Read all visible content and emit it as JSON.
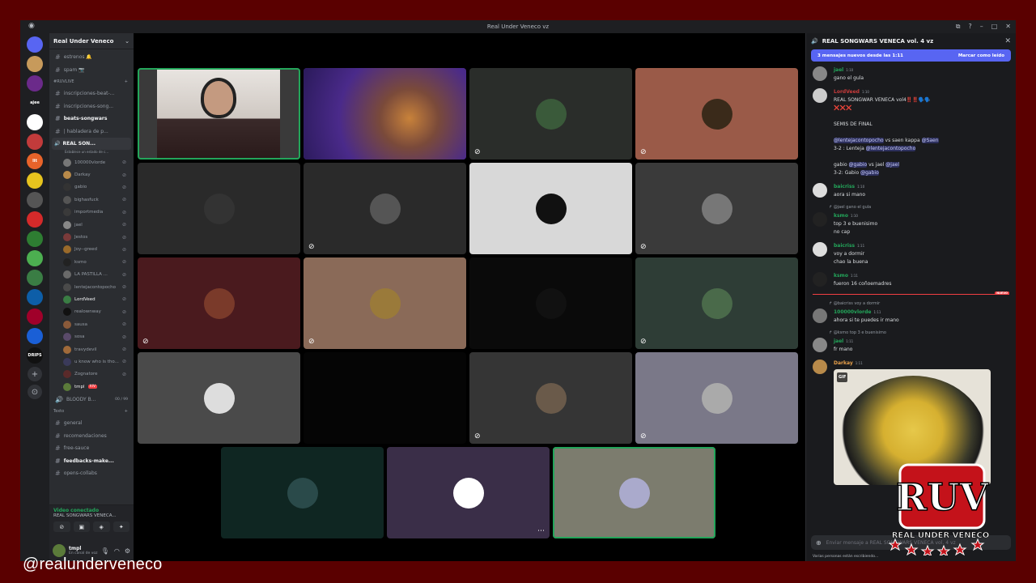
{
  "window": {
    "title": "Real Under Veneco vz",
    "controls": [
      "⧉",
      "?",
      "–",
      "□",
      "✕"
    ]
  },
  "colors": {
    "accent": "#5865f2",
    "speaking": "#23a55a",
    "brand_bg": "#5a0000",
    "danger": "#f23f43"
  },
  "servers": [
    {
      "color": "#c79a5b",
      "txt": ""
    },
    {
      "color": "#6b2a8a",
      "txt": ""
    },
    {
      "color": "#1e1f22",
      "txt": "ajee"
    },
    {
      "color": "#ffffff",
      "txt": ""
    },
    {
      "color": "#c23b3b",
      "txt": ""
    },
    {
      "color": "#e8632a",
      "txt": "lit"
    },
    {
      "color": "#e6c31e",
      "txt": ""
    },
    {
      "color": "#555555",
      "txt": ""
    },
    {
      "color": "#d42a2a",
      "txt": ""
    },
    {
      "color": "#2e7d32",
      "txt": ""
    },
    {
      "color": "#4caf50",
      "txt": ""
    },
    {
      "color": "#3a7d44",
      "txt": ""
    },
    {
      "color": "#0d5ea8",
      "txt": ""
    },
    {
      "color": "#a0002a",
      "txt": ""
    },
    {
      "color": "#1a5fd6",
      "txt": ""
    },
    {
      "color": "#111111",
      "txt": "DRIPS"
    }
  ],
  "sidebar": {
    "server_name": "Real Under Veneco",
    "top_channels": [
      {
        "name": "estrenos 🔔"
      },
      {
        "name": "spam 📷"
      }
    ],
    "category_live": "#RUVLIVE",
    "live_channels": [
      {
        "name": "inscripciones-beat-...",
        "bold": false
      },
      {
        "name": "inscripciones-song...",
        "bold": false
      },
      {
        "name": "beats-songwars",
        "bold": true
      },
      {
        "name": "| habladera de p...",
        "bold": false
      }
    ],
    "voice_channel": "REAL SON...",
    "voice_status": "Establece un estado de c...",
    "voice_users": [
      {
        "name": "100000vlorde",
        "color": "#777"
      },
      {
        "name": "Darkay",
        "color": "#b88a4a"
      },
      {
        "name": "gabio",
        "color": "#333"
      },
      {
        "name": "bighasfuck",
        "color": "#555"
      },
      {
        "name": "importmedia",
        "color": "#3a3a3a"
      },
      {
        "name": "jael",
        "color": "#888"
      },
      {
        "name": "Jestos",
        "color": "#7a3a3a"
      },
      {
        "name": "Joy--greed",
        "color": "#9a6a2a"
      },
      {
        "name": "ksmo",
        "color": "#222"
      },
      {
        "name": "LA PASTILLA ...",
        "color": "#6a6a6a"
      },
      {
        "name": "lentejacontopocho",
        "color": "#4a4a4a"
      },
      {
        "name": "LordVeed",
        "color": "#3a7d44"
      },
      {
        "name": "realownway",
        "color": "#111"
      },
      {
        "name": "sausa",
        "color": "#8a5a3a"
      },
      {
        "name": "sosa",
        "color": "#5a4a6a"
      },
      {
        "name": "travydevil",
        "color": "#a06a3a"
      },
      {
        "name": "u know who is tho...",
        "color": "#3a3a5a"
      },
      {
        "name": "Zognatore",
        "color": "#5a2a2a"
      },
      {
        "name": "tmpl",
        "color": "#5b7b3a"
      }
    ],
    "live_badge": "XIV",
    "other_voice": "BLOODY B...",
    "other_voice_count": "00 / 99",
    "category_text": "Texto",
    "text_channels": [
      {
        "name": "general",
        "bold": false
      },
      {
        "name": "recomendaciones",
        "bold": false
      },
      {
        "name": "free-sauce",
        "bold": false
      },
      {
        "name": "feedbacks-make...",
        "bold": true
      },
      {
        "name": "opens-collabs",
        "bold": false
      }
    ],
    "vc_status": "Video conectado",
    "vc_channel": "REAL SONGWARS VENECA...",
    "user_name": "tmpl",
    "user_status": "En canal de voz"
  },
  "tiles": [
    {
      "bg": "#3a3a3a",
      "avatar": "cam",
      "speaking": true,
      "mute": false
    },
    {
      "bg": "#4a2a8a",
      "avatar": "cam2",
      "speaking": false,
      "mute": false
    },
    {
      "bg": "#2a2d2a",
      "avatar": "#3a5a3a",
      "speaking": false,
      "mute": true
    },
    {
      "bg": "#9a5a48",
      "avatar": "#3a2a1a",
      "speaking": false,
      "mute": true
    },
    {
      "bg": "#2a2a2a",
      "avatar": "#333",
      "speaking": false,
      "mute": false
    },
    {
      "bg": "#2a2a2a",
      "avatar": "#555",
      "speaking": false,
      "mute": true
    },
    {
      "bg": "#d8d8d8",
      "avatar": "#111",
      "speaking": false,
      "mute": false
    },
    {
      "bg": "#3a3a3a",
      "avatar": "#777",
      "speaking": false,
      "mute": true
    },
    {
      "bg": "#4a1a1e",
      "avatar": "#7a3a2a",
      "speaking": false,
      "mute": true
    },
    {
      "bg": "#8a6a58",
      "avatar": "#9a7a3a",
      "speaking": false,
      "mute": true
    },
    {
      "bg": "#0a0a0a",
      "avatar": "#111",
      "speaking": false,
      "mute": false
    },
    {
      "bg": "#2e3d36",
      "avatar": "#4a6a4a",
      "speaking": false,
      "mute": true
    },
    {
      "bg": "#4a4a4a",
      "avatar": "#ddd",
      "speaking": false,
      "mute": false
    },
    {
      "bg": "#050505",
      "avatar": "none",
      "speaking": false,
      "mute": false
    },
    {
      "bg": "#353535",
      "avatar": "#6a5a4a",
      "speaking": false,
      "mute": true
    },
    {
      "bg": "#7a7888",
      "avatar": "#aaa",
      "speaking": false,
      "mute": true
    },
    {
      "bg": "#0f2622",
      "avatar": "#2a4a4a",
      "speaking": false,
      "mute": false
    },
    {
      "bg": "#3a2e48",
      "avatar": "#fff",
      "speaking": false,
      "mute": false,
      "more": true
    },
    {
      "bg": "#7c7c6e",
      "avatar": "#aac",
      "speaking": true,
      "mute": false
    }
  ],
  "chat": {
    "title": "REAL SONGWARS VENECA vol. 4 vz",
    "new_messages": "3 mensajes nuevos desde las 1:11",
    "mark_read": "Marcar como leído",
    "messages": [
      {
        "author": "jael",
        "color": "#23a55a",
        "av": "#888",
        "ts": "1:10",
        "lines": [
          "gano el gula"
        ]
      },
      {
        "author": "LordVeed",
        "color": "#c93b3b",
        "av": "#ccc",
        "ts": "1:10",
        "lines": [
          "REAL SONGWAR VENECA vol4‼️‼️🗣️🗣️",
          "❌❌❌",
          "",
          "SEMIS DE FINAL",
          "",
          "@lentejacontopocho vs saen kappa @Saen",
          "3-2 : Lenteja @lentejacontopocho",
          "",
          "gabio @gabio vs jael @jael",
          "3-2: Gabio @gabio"
        ]
      },
      {
        "author": "baicriss",
        "color": "#23a55a",
        "av": "#ddd",
        "ts": "1:10",
        "lines": [
          "aora si mano"
        ]
      }
    ],
    "reply1": "@jael gano el gula",
    "msg_ksmo1": {
      "author": "ksmo",
      "ts": "1:10",
      "lines": [
        "top 3 e buenisimo",
        "no cap"
      ]
    },
    "msg_baicriss2": {
      "author": "baicriss",
      "ts": "1:11",
      "lines": [
        "voy a dormir",
        "chao la buena"
      ]
    },
    "msg_ksmo2": {
      "author": "ksmo",
      "ts": "1:11",
      "lines": [
        "fueron 16 coñoemadres"
      ]
    },
    "new_label": "NUEVO",
    "reply2": "@baicriss voy a dormir",
    "msg_vlorde": {
      "author": "100000vlorde",
      "ts": "1:11",
      "lines": [
        "ahora si te puedes ir mano"
      ]
    },
    "reply3": "@ksmo top 3 e buenisimo",
    "msg_jael2": {
      "author": "jael",
      "ts": "1:11",
      "lines": [
        "fr mano"
      ]
    },
    "msg_darkay": {
      "author": "Darkay",
      "ts": "1:11"
    },
    "gif_tag": "GIF",
    "input_placeholder": "Enviar mensaje a REAL SONGWARS VENECA vol. 4 vz",
    "typing": "Varias personas están escribiendo..."
  },
  "watermark": {
    "handle": "@realunderveneco",
    "logo_text": "RUV",
    "logo_sub": "REAL UNDER VENECO"
  }
}
